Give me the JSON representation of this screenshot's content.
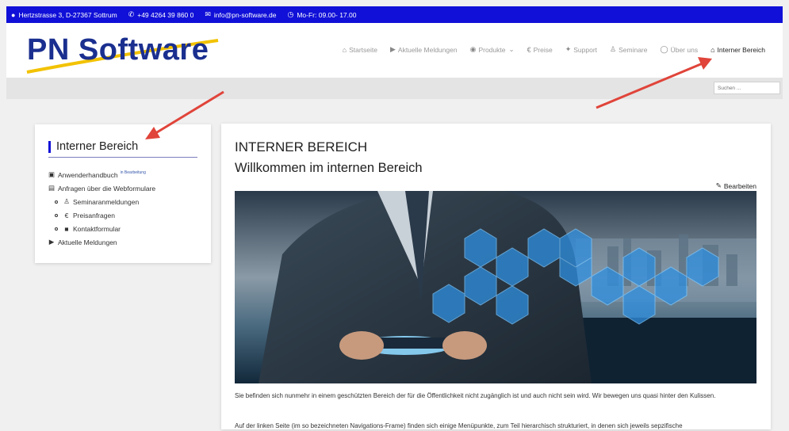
{
  "topbar": {
    "address": "Hertzstrasse 3, D-27367 Sottrum",
    "phone": "+49 4264 39 860 0",
    "email": "info@pn-software.de",
    "hours": "Mo-Fr: 09.00- 17.00"
  },
  "header": {
    "logo": "PN Software",
    "nav": [
      {
        "label": "Startseite",
        "icon": "home-icon"
      },
      {
        "label": "Aktuelle Meldungen",
        "icon": "megaphone-icon"
      },
      {
        "label": "Produkte",
        "icon": "cd-icon"
      },
      {
        "label": "Preise",
        "icon": "euro-icon"
      },
      {
        "label": "Support",
        "icon": "handshake-icon"
      },
      {
        "label": "Seminare",
        "icon": "group-icon"
      },
      {
        "label": "Über uns",
        "icon": "chat-icon"
      },
      {
        "label": "Interner Bereich",
        "icon": "lock-home-icon"
      }
    ]
  },
  "search": {
    "placeholder": "Suchen ..."
  },
  "sidebar": {
    "title": "Interner Bereich",
    "items": [
      {
        "label": "Anwenderhandbuch",
        "badge": "in Bearbeitung",
        "icon": "book-icon"
      },
      {
        "label": "Anfragen über die Webformulare",
        "icon": "form-icon"
      },
      {
        "label": "Seminaranmeldungen",
        "icon": "group-icon"
      },
      {
        "label": "Preisanfragen",
        "icon": "euro-icon"
      },
      {
        "label": "Kontaktformular",
        "icon": "briefcase-icon"
      },
      {
        "label": "Aktuelle Meldungen",
        "icon": "megaphone-icon"
      }
    ]
  },
  "content": {
    "title": "INTERNER BEREICH",
    "subtitle": "Willkommen im internen Bereich",
    "edit_label": "Bearbeiten",
    "paragraph1": "Sie befinden sich nunmehr in einem geschützten Bereich der für die Öffentlichkeit nicht zugänglich ist und auch nicht sein wird. Wir bewegen uns quasi hinter den Kulissen.",
    "paragraph2": "Auf der linken Seite (im so bezeichneten Navigations-Frame) finden sich einige Menüpunkte, zum Teil hierarchisch strukturiert, in denen sich jeweils sepzifische"
  },
  "colors": {
    "accent": "#1010d8",
    "logo": "#1a2f8f",
    "arrow": "#e0443a"
  }
}
